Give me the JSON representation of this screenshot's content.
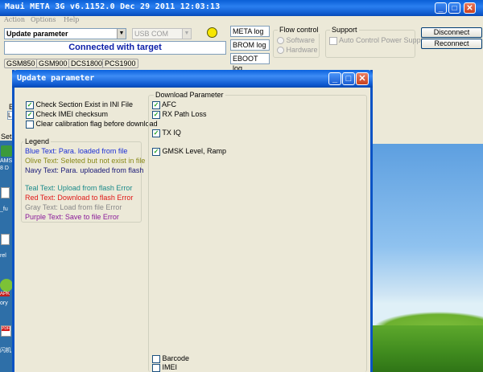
{
  "app": {
    "title": "Maui META 3G v6.1152.0 Dec 29 2011 12:03:13",
    "menu": [
      "Action",
      "Options",
      "Help"
    ],
    "window_controls": {
      "minimize": "_",
      "maximize": "□",
      "close": "✕"
    }
  },
  "toolbar": {
    "mode_select": "Update parameter",
    "port_select": "USB COM",
    "status": "Connected with target",
    "status_indicator_color": "#f7e600",
    "meta_log": "META log",
    "brom_log": "BROM log",
    "eboot_log": "EBOOT log",
    "flow_control": {
      "label": "Flow control",
      "options": [
        "Software",
        "Hardware"
      ]
    },
    "support": {
      "label": "Support",
      "option": "Auto Control Power Supply"
    },
    "disconnect": "Disconnect",
    "reconnect": "Reconnect"
  },
  "bands": [
    "GSM850",
    "GSM900",
    "DCS1800",
    "PCS1900"
  ],
  "background_fragments": {
    "left_b": "B",
    "left_l": "L",
    "set": "Set",
    "desk": [
      "AMS",
      "8 D",
      "_fu",
      "rel",
      "APK",
      "ory",
      "PDF",
      "闪机"
    ]
  },
  "dialog": {
    "title": "Update parameter",
    "options": [
      {
        "label": "Check Section Exist in INI File",
        "checked": true
      },
      {
        "label": "Check IMEI checksum",
        "checked": true
      },
      {
        "label": "Clear calibration flag before download",
        "checked": false
      }
    ],
    "legend": {
      "title": "Legend",
      "items": [
        {
          "text": "Blue Text: Para. loaded from file",
          "color": "#1c2fd6"
        },
        {
          "text": "Olive Text: Seleted but not exist in file",
          "color": "#8a8a1a"
        },
        {
          "text": "Navy Text: Para. uploaded from flash",
          "color": "#1a1a78"
        },
        {
          "text": "Teal Text: Upload from flash Error",
          "color": "#1a8a8a"
        },
        {
          "text": "Red Text: Download to flash Error",
          "color": "#e01818"
        },
        {
          "text": "Gray Text: Load from file Error",
          "color": "#8a8a8a"
        },
        {
          "text": "Purple Text: Save to file Error",
          "color": "#8a1a9a"
        }
      ]
    },
    "download_parameter": {
      "title": "Download Parameter",
      "items": [
        {
          "label": "AFC",
          "checked": true
        },
        {
          "label": "RX Path Loss",
          "checked": true
        },
        {
          "label": "TX IQ",
          "checked": true
        },
        {
          "label": "GMSK Level, Ramp",
          "checked": true
        },
        {
          "label": "Barcode",
          "checked": false
        },
        {
          "label": "IMEI",
          "checked": false
        }
      ]
    }
  }
}
